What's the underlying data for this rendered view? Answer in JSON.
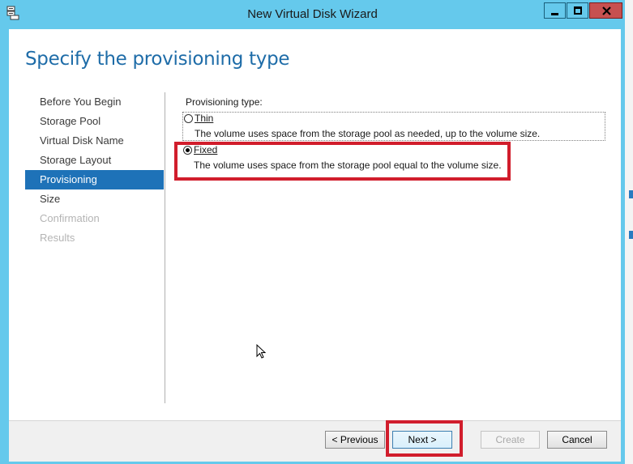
{
  "window": {
    "title": "New Virtual Disk Wizard",
    "icons": {
      "app": "virtual-disk-app-icon",
      "minimize": "minimize-icon",
      "maximize": "maximize-icon",
      "close": "close-icon"
    },
    "close_color": "#c75050",
    "frame_color": "#65c9ec"
  },
  "page": {
    "title": "Specify the provisioning type"
  },
  "nav": {
    "items": [
      {
        "label": "Before You Begin",
        "state": "normal"
      },
      {
        "label": "Storage Pool",
        "state": "normal"
      },
      {
        "label": "Virtual Disk Name",
        "state": "normal"
      },
      {
        "label": "Storage Layout",
        "state": "normal"
      },
      {
        "label": "Provisioning",
        "state": "active"
      },
      {
        "label": "Size",
        "state": "normal"
      },
      {
        "label": "Confirmation",
        "state": "disabled"
      },
      {
        "label": "Results",
        "state": "disabled"
      }
    ],
    "active_color": "#1e72b8"
  },
  "provisioning": {
    "label": "Provisioning type:",
    "options": [
      {
        "name": "Thin",
        "description": "The volume uses space from the storage pool as needed, up to the volume size.",
        "selected": false
      },
      {
        "name": "Fixed",
        "description": "The volume uses space from the storage pool equal to the volume size.",
        "selected": true
      }
    ]
  },
  "buttons": {
    "previous": "< Previous",
    "next": "Next >",
    "create": "Create",
    "cancel": "Cancel"
  },
  "highlight_color": "#d11d2c"
}
